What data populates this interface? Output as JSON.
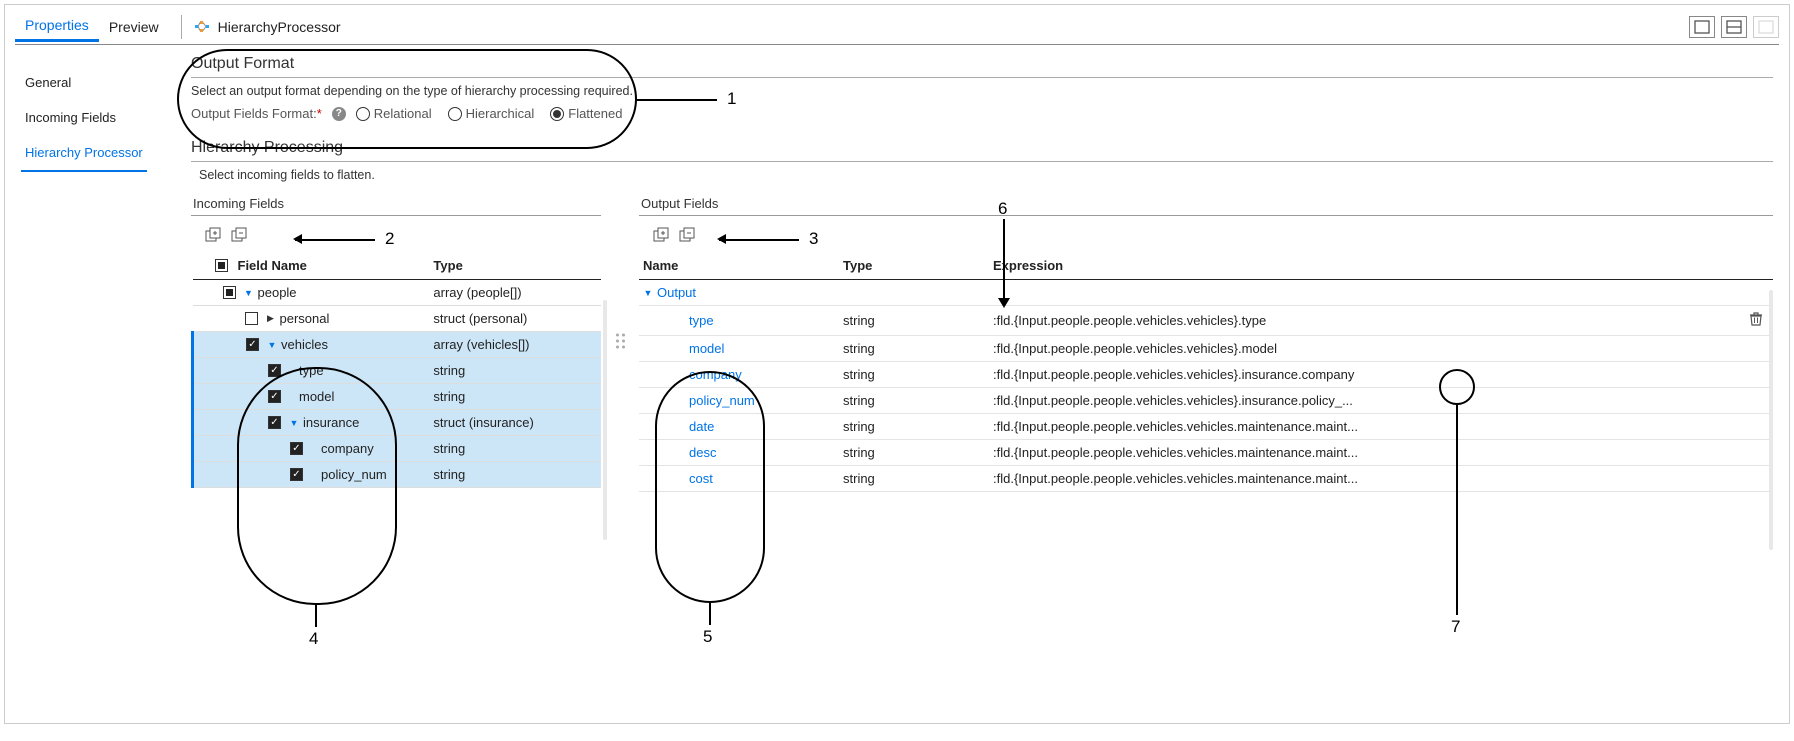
{
  "tabs": {
    "properties": "Properties",
    "preview": "Preview"
  },
  "processor_name": "HierarchyProcessor",
  "sidenav": {
    "general": "General",
    "incoming": "Incoming Fields",
    "hierarchy": "Hierarchy Processor"
  },
  "output_format": {
    "title": "Output Format",
    "desc": "Select an output format depending on the type of hierarchy processing required.",
    "label": "Output Fields Format:",
    "options": {
      "relational": "Relational",
      "hierarchical": "Hierarchical",
      "flattened": "Flattened"
    },
    "selected": "flattened"
  },
  "hierarchy_processing": {
    "title": "Hierarchy Processing",
    "desc": "Select incoming fields to flatten."
  },
  "incoming": {
    "title": "Incoming Fields",
    "headers": {
      "field_name": "Field Name",
      "type": "Type"
    },
    "rows": [
      {
        "name": "people",
        "type": "array (people[])",
        "indent": 1,
        "check": "mixed",
        "toggle": "down",
        "sel": false
      },
      {
        "name": "personal",
        "type": "struct (personal)",
        "indent": 2,
        "check": "none",
        "toggle": "right",
        "sel": false
      },
      {
        "name": "vehicles",
        "type": "array (vehicles[])",
        "indent": 2,
        "check": "checked",
        "toggle": "down",
        "sel": true
      },
      {
        "name": "type",
        "type": "string",
        "indent": 3,
        "check": "checked",
        "toggle": "",
        "sel": true
      },
      {
        "name": "model",
        "type": "string",
        "indent": 3,
        "check": "checked",
        "toggle": "",
        "sel": true
      },
      {
        "name": "insurance",
        "type": "struct (insurance)",
        "indent": 3,
        "check": "checked",
        "toggle": "down",
        "sel": true
      },
      {
        "name": "company",
        "type": "string",
        "indent": 4,
        "check": "checked",
        "toggle": "",
        "sel": true
      },
      {
        "name": "policy_num",
        "type": "string",
        "indent": 4,
        "check": "checked",
        "toggle": "",
        "sel": true
      }
    ]
  },
  "output": {
    "title": "Output Fields",
    "headers": {
      "name": "Name",
      "type": "Type",
      "expression": "Expression"
    },
    "root": "Output",
    "rows": [
      {
        "name": "type",
        "type": "string",
        "expr": ":fld.{Input.people.people.vehicles.vehicles}.type",
        "trash": true
      },
      {
        "name": "model",
        "type": "string",
        "expr": ":fld.{Input.people.people.vehicles.vehicles}.model",
        "trash": false
      },
      {
        "name": "company",
        "type": "string",
        "expr": ":fld.{Input.people.people.vehicles.vehicles}.insurance.company",
        "trash": false
      },
      {
        "name": "policy_num",
        "type": "string",
        "expr": ":fld.{Input.people.people.vehicles.vehicles}.insurance.policy_...",
        "trash": false
      },
      {
        "name": "date",
        "type": "string",
        "expr": ":fld.{Input.people.people.vehicles.vehicles.maintenance.maint...",
        "trash": false
      },
      {
        "name": "desc",
        "type": "string",
        "expr": ":fld.{Input.people.people.vehicles.vehicles.maintenance.maint...",
        "trash": false
      },
      {
        "name": "cost",
        "type": "string",
        "expr": ":fld.{Input.people.people.vehicles.vehicles.maintenance.maint...",
        "trash": false
      }
    ]
  },
  "callouts": {
    "1": "1",
    "2": "2",
    "3": "3",
    "4": "4",
    "5": "5",
    "6": "6",
    "7": "7"
  }
}
